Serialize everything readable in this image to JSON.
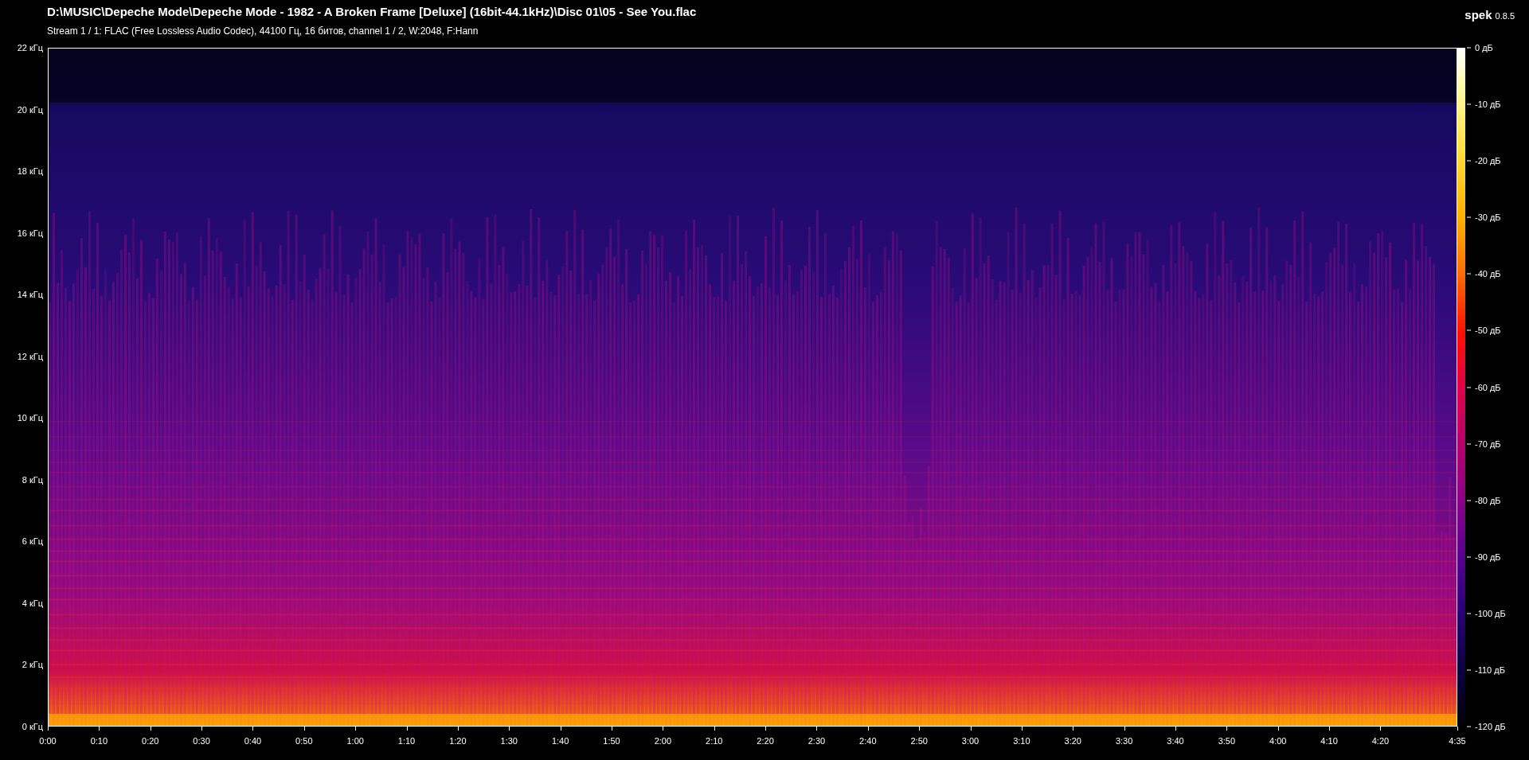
{
  "header": {
    "file_path": "D:\\MUSIC\\Depeche Mode\\Depeche Mode - 1982 - A Broken Frame [Deluxe] (16bit-44.1kHz)\\Disc 01\\05 - See You.flac",
    "stream_info": "Stream 1 / 1: FLAC (Free Lossless Audio Codec), 44100 Гц, 16 битов, channel 1 / 2, W:2048, F:Hann",
    "app_name": "spek",
    "app_version": "0.8.5"
  },
  "frequency_axis": [
    "22 кГц",
    "20 кГц",
    "18 кГц",
    "16 кГц",
    "14 кГц",
    "12 кГц",
    "10 кГц",
    "8 кГц",
    "6 кГц",
    "4 кГц",
    "2 кГц",
    "0 кГц"
  ],
  "time_axis": [
    "0:00",
    "0:10",
    "0:20",
    "0:30",
    "0:40",
    "0:50",
    "1:00",
    "1:10",
    "1:20",
    "1:30",
    "1:40",
    "1:50",
    "2:00",
    "2:10",
    "2:20",
    "2:30",
    "2:40",
    "2:50",
    "3:00",
    "3:10",
    "3:20",
    "3:30",
    "3:40",
    "3:50",
    "4:00",
    "4:10",
    "4:20",
    "4:35"
  ],
  "level_scale": [
    "0 дБ",
    "-10 дБ",
    "-20 дБ",
    "-30 дБ",
    "-40 дБ",
    "-50 дБ",
    "-60 дБ",
    "-70 дБ",
    "-80 дБ",
    "-90 дБ",
    "-100 дБ",
    "-110 дБ",
    "-120 дБ"
  ]
}
